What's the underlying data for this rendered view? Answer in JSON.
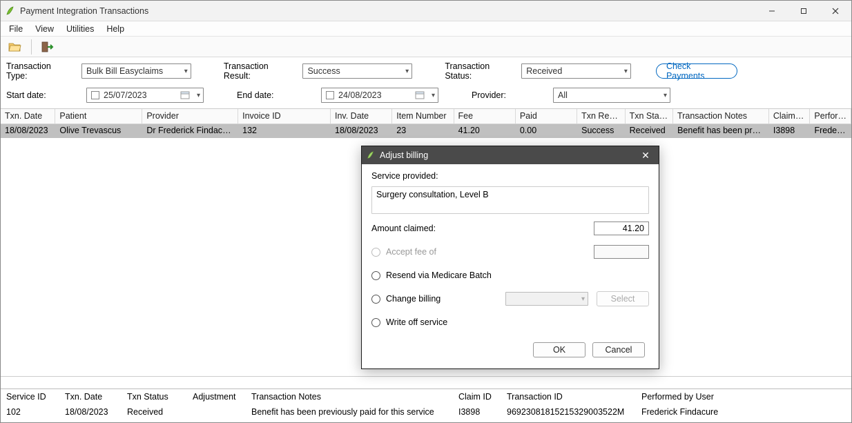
{
  "window": {
    "title": "Payment Integration Transactions"
  },
  "menu": {
    "file": "File",
    "view": "View",
    "utilities": "Utilities",
    "help": "Help"
  },
  "filters": {
    "txn_type_label": "Transaction Type:",
    "txn_type_value": "Bulk Bill Easyclaims",
    "txn_result_label": "Transaction Result:",
    "txn_result_value": "Success",
    "txn_status_label": "Transaction Status:",
    "txn_status_value": "Received",
    "check_payments_btn": "Check Payments",
    "start_date_label": "Start date:",
    "start_date_value": "25/07/2023",
    "end_date_label": "End date:",
    "end_date_value": "24/08/2023",
    "provider_label": "Provider:",
    "provider_value": "All"
  },
  "grid": {
    "headers": {
      "txn_date": "Txn. Date",
      "patient": "Patient",
      "provider": "Provider",
      "invoice_id": "Invoice ID",
      "inv_date": "Inv. Date",
      "item_number": "Item Number",
      "fee": "Fee",
      "paid": "Paid",
      "txn_result": "Txn Result",
      "txn_status": "Txn Status",
      "txn_notes": "Transaction Notes",
      "claim_id": "Claim ID",
      "performed": "Performed"
    },
    "rows": [
      {
        "txn_date": "18/08/2023",
        "patient": "Olive Trevascus",
        "provider": "Dr Frederick Findacure",
        "invoice_id": "132",
        "inv_date": "18/08/2023",
        "item_number": "23",
        "fee": "41.20",
        "paid": "0.00",
        "txn_result": "Success",
        "txn_status": "Received",
        "txn_notes": "Benefit has been previousl",
        "claim_id": "I3898",
        "performed": "Frederick"
      }
    ]
  },
  "detail": {
    "headers": {
      "service_id": "Service ID",
      "txn_date": "Txn. Date",
      "txn_status": "Txn Status",
      "adjustment": "Adjustment",
      "txn_notes": "Transaction Notes",
      "claim_id": "Claim ID",
      "txn_id": "Transaction ID",
      "performed": "Performed by User"
    },
    "row": {
      "service_id": "102",
      "txn_date": "18/08/2023",
      "txn_status": "Received",
      "adjustment": "",
      "txn_notes": "Benefit has been previously paid for this service",
      "claim_id": "I3898",
      "txn_id": "96923081815215329003522M",
      "performed": "Frederick Findacure"
    }
  },
  "dialog": {
    "title": "Adjust billing",
    "service_label": "Service provided:",
    "service_value": "Surgery consultation, Level B",
    "amount_label": "Amount claimed:",
    "amount_value": "41.20",
    "opt_accept": "Accept fee of",
    "opt_resend": "Resend via Medicare Batch",
    "opt_change": "Change billing",
    "opt_writeoff": "Write off service",
    "select_btn": "Select",
    "ok": "OK",
    "cancel": "Cancel"
  }
}
